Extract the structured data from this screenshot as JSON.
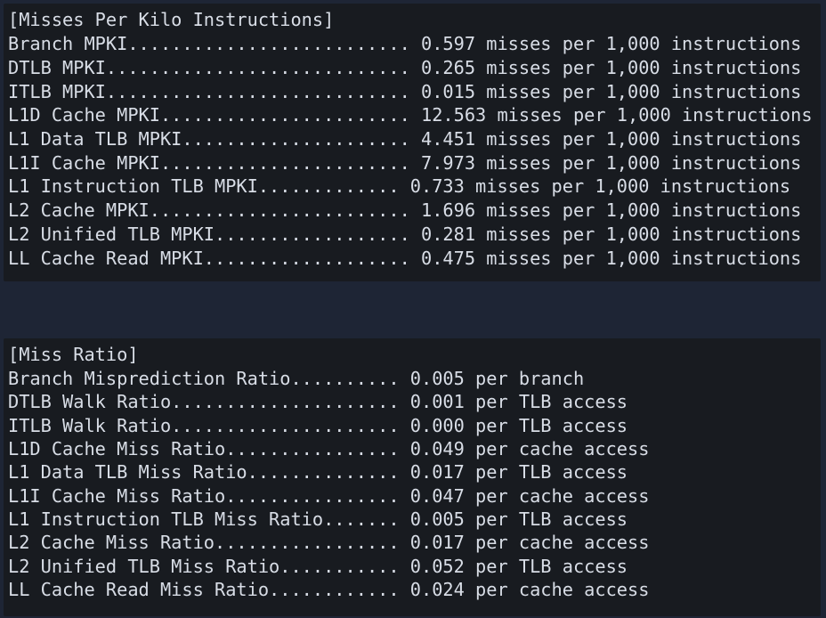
{
  "mpki": {
    "header": "[Misses Per Kilo Instructions]",
    "lines": [
      "Branch MPKI.......................... 0.597 misses per 1,000 instructions",
      "DTLB MPKI............................ 0.265 misses per 1,000 instructions",
      "ITLB MPKI............................ 0.015 misses per 1,000 instructions",
      "L1D Cache MPKI....................... 12.563 misses per 1,000 instructions",
      "L1 Data TLB MPKI..................... 4.451 misses per 1,000 instructions",
      "L1I Cache MPKI....................... 7.973 misses per 1,000 instructions",
      "L1 Instruction TLB MPKI............. 0.733 misses per 1,000 instructions",
      "L2 Cache MPKI........................ 1.696 misses per 1,000 instructions",
      "L2 Unified TLB MPKI.................. 0.281 misses per 1,000 instructions",
      "LL Cache Read MPKI................... 0.475 misses per 1,000 instructions"
    ]
  },
  "ratio": {
    "header": "[Miss Ratio]",
    "lines": [
      "Branch Misprediction Ratio.......... 0.005 per branch",
      "DTLB Walk Ratio..................... 0.001 per TLB access",
      "ITLB Walk Ratio..................... 0.000 per TLB access",
      "L1D Cache Miss Ratio................ 0.049 per cache access",
      "L1 Data TLB Miss Ratio.............. 0.017 per TLB access",
      "L1I Cache Miss Ratio................ 0.047 per cache access",
      "L1 Instruction TLB Miss Ratio....... 0.005 per TLB access",
      "L2 Cache Miss Ratio................. 0.017 per cache access",
      "L2 Unified TLB Miss Ratio........... 0.052 per TLB access",
      "LL Cache Read Miss Ratio............ 0.024 per cache access"
    ]
  }
}
